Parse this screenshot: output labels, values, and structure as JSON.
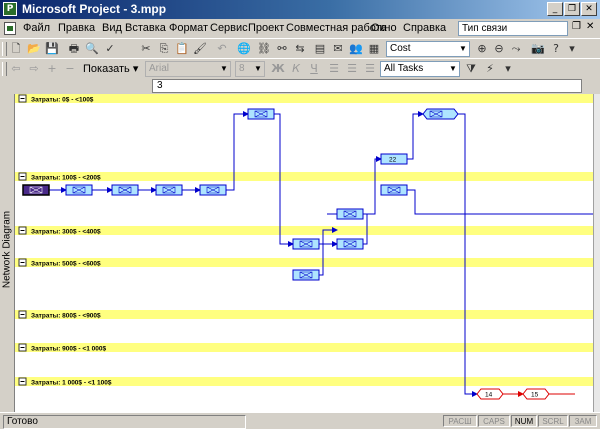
{
  "window": {
    "title": "Microsoft Project - 3.mpp",
    "app_icon": "microsoft-project-icon"
  },
  "menu": {
    "items": [
      "Файл",
      "Правка",
      "Вид",
      "Вставка",
      "Формат",
      "Сервис",
      "Проект",
      "Совместная работа",
      "Окно",
      "Справка"
    ],
    "help_box": "Тип связи"
  },
  "toolbar": {
    "field_combo": "Cost",
    "show_button": "Показать",
    "font_combo": "Arial",
    "size_combo": "8",
    "filter_combo": "All Tasks"
  },
  "entry_bar": {
    "value": "3"
  },
  "sidebar": {
    "label": "Network Diagram"
  },
  "diagram": {
    "band_color": "#ffff80",
    "bands": [
      {
        "label": "Затраты: 0$ - <100$"
      },
      {
        "label": "Затраты: 100$ - <200$"
      },
      {
        "label": "Затраты: 300$ - <400$"
      },
      {
        "label": "Затраты: 500$ - <600$"
      },
      {
        "label": "Затраты: 800$ - <900$"
      },
      {
        "label": "Затраты: 900$ - <1 000$"
      },
      {
        "label": "Затраты: 1 000$ - <1 100$"
      }
    ],
    "nodes": [
      {
        "name": "node-start",
        "label": "",
        "style": "start"
      },
      {
        "name": "node-a1",
        "label": "",
        "style": "task"
      },
      {
        "name": "node-a2",
        "label": "",
        "style": "task"
      },
      {
        "name": "node-a3",
        "label": "",
        "style": "task"
      },
      {
        "name": "node-a4",
        "label": "",
        "style": "task"
      },
      {
        "name": "node-b1",
        "label": "",
        "style": "task"
      },
      {
        "name": "node-c1",
        "label": "",
        "style": "task"
      },
      {
        "name": "node-c2",
        "label": "",
        "style": "task"
      },
      {
        "name": "node-c3",
        "label": "",
        "style": "task"
      },
      {
        "name": "node-d1",
        "label": "",
        "style": "task"
      },
      {
        "name": "node-22",
        "label": "22",
        "style": "task-numbered"
      },
      {
        "name": "node-e1",
        "label": "",
        "style": "task"
      },
      {
        "name": "node-f1",
        "label": "",
        "style": "milestone"
      },
      {
        "name": "node-f2",
        "label": "",
        "style": "milestone"
      },
      {
        "name": "node-14",
        "label": "14",
        "style": "critical-milestone"
      },
      {
        "name": "node-15",
        "label": "15",
        "style": "critical-milestone"
      }
    ],
    "link_color": "#0000cc",
    "critical_color": "#dd0000"
  },
  "status": {
    "ready": "Готово",
    "indicators": [
      "РАСШ",
      "CAPS",
      "NUM",
      "SCRL",
      "ЗАМ"
    ],
    "active": [
      "NUM"
    ]
  }
}
